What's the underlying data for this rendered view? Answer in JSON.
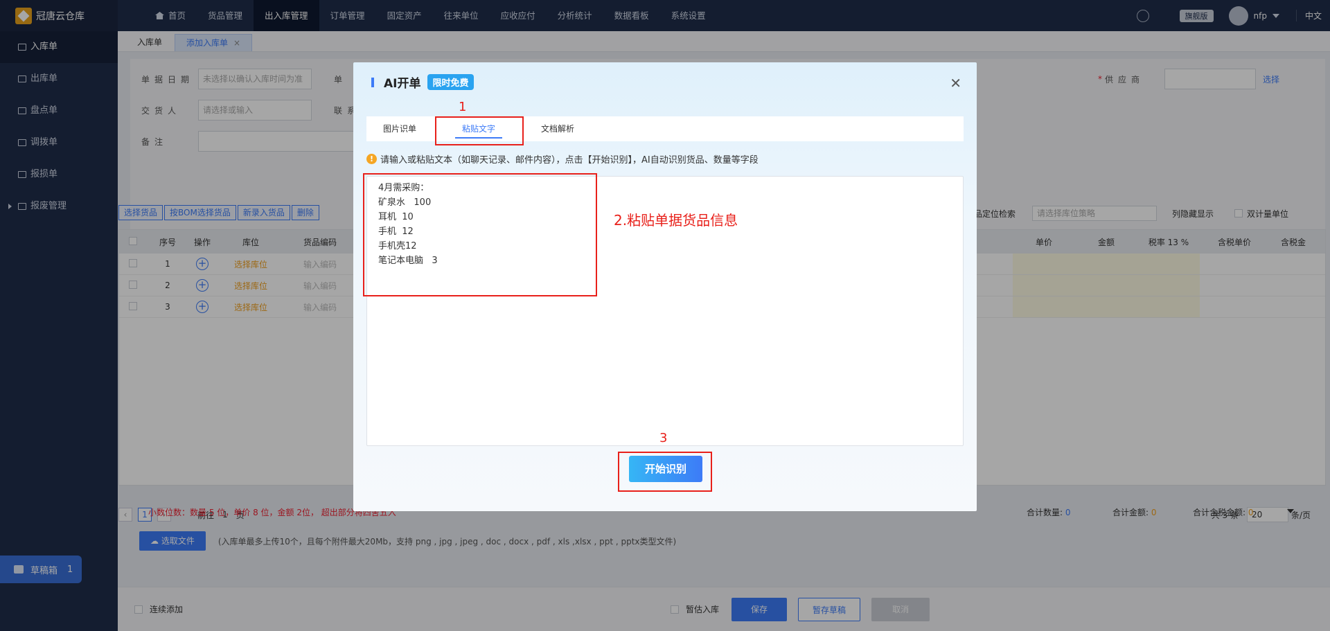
{
  "app": {
    "name": "冠唐云仓库",
    "edition": "旗舰版",
    "user": "nfp",
    "language": "中文"
  },
  "nav": [
    "首页",
    "货品管理",
    "出入库管理",
    "订单管理",
    "固定资产",
    "往来单位",
    "应收应付",
    "分析统计",
    "数据看板",
    "系统设置"
  ],
  "sidebar": [
    "入库单",
    "出库单",
    "盘点单",
    "调拨单",
    "报损单",
    "报废管理"
  ],
  "draft": {
    "label": "草稿箱",
    "count": "1"
  },
  "tabs": [
    "入库单",
    "添加入库单"
  ],
  "form": {
    "date_label": "单据日期",
    "date_placeholder": "未选择以确认入库时间为准",
    "danhao_label": "单",
    "supplier_label": "供应商",
    "supplier_link": "选择",
    "deliver_label": "交货人",
    "deliver_placeholder": "请选择或输入",
    "contact_label": "联系",
    "remark_label": "备注"
  },
  "toolbar": [
    "选择货品",
    "按BOM选择货品",
    "新录入货品",
    "删除"
  ],
  "toolbar_right": {
    "locate": "货品定位检索",
    "loc_placeholder": "请选择库位策略",
    "hidden_cols": "列隐藏显示",
    "dual_unit": "双计量单位"
  },
  "table": {
    "headers_left": [
      "序号",
      "操作",
      "库位",
      "货品编码"
    ],
    "headers_right": [
      "单价",
      "金额",
      "税率",
      "13",
      "%",
      "含税单价",
      "含税金"
    ],
    "rows": [
      {
        "idx": "1",
        "loc": "选择库位",
        "code": "输入编码"
      },
      {
        "idx": "2",
        "loc": "选择库位",
        "code": "输入编码"
      },
      {
        "idx": "3",
        "loc": "选择库位",
        "code": "输入编码"
      }
    ]
  },
  "pager": {
    "page": "1",
    "goto": "前往",
    "goto_val": "1",
    "page_unit": "页",
    "total": "共 3 条",
    "size": "20",
    "size_unit": "条/页"
  },
  "summary": {
    "decimal_note": "小数位数：数量 5 位，单价 8 位，金额 2位， 超出部分将四舍五入",
    "qty_label": "合计数量:",
    "qty": "0",
    "amt_label": "合计金额:",
    "amt": "0",
    "tax_amt_label": "合计含税金额:",
    "tax_amt": "0"
  },
  "upload": {
    "button": "选取文件",
    "note": "(入库单最多上传10个，且每个附件最大20Mb，支持 png , jpg , jpeg , doc , docx , pdf , xls ,xlsx , ppt , pptx类型文件)"
  },
  "footer": {
    "continuous": "连续添加",
    "temp": "暂估入库",
    "save": "保存",
    "save_draft": "暂存草稿",
    "cancel": "取消"
  },
  "modal": {
    "title": "AI开单",
    "badge": "限时免费",
    "tabs": [
      "图片识单",
      "粘贴文字",
      "文档解析"
    ],
    "hint": "请输入或粘贴文本（如聊天记录、邮件内容），点击【开始识别】，AI自动识别货品、数量等字段",
    "text_lines": [
      "4月需采购：",
      "矿泉水   100",
      "耳机  10",
      "手机  12",
      "手机壳12",
      "笔记本电脑   3"
    ],
    "start_button": "开始识别"
  },
  "annotations": {
    "step1": "1",
    "step2": "2.粘贴单据货品信息",
    "step3": "3"
  }
}
